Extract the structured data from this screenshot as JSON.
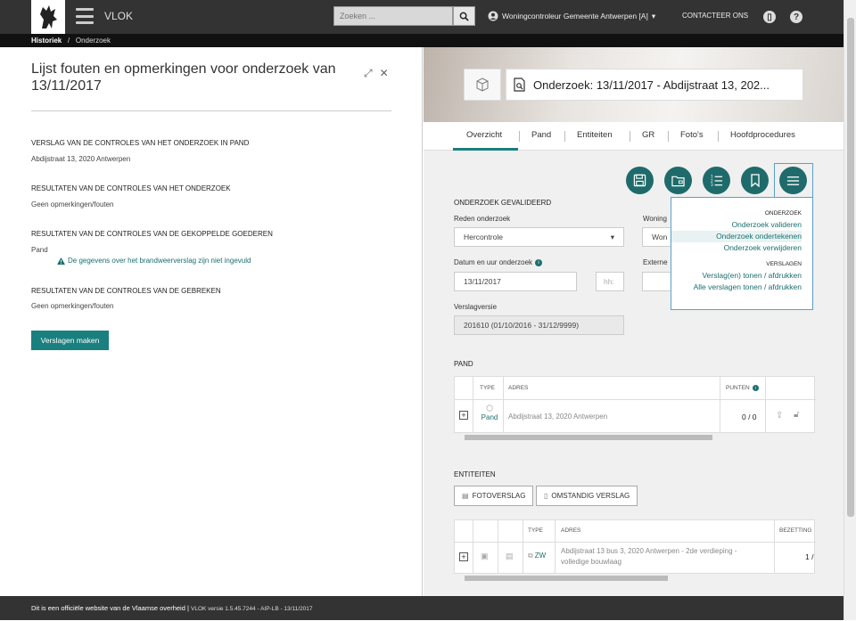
{
  "app": {
    "name": "VLOK"
  },
  "search": {
    "placeholder": "Zoeken ..."
  },
  "user": {
    "label": "Woningcontroleur Gemeente Antwerpen [A]"
  },
  "header": {
    "contact": "CONTACTEER ONS"
  },
  "breadcrumb": {
    "home": "Historiek",
    "sep": "/",
    "current": "Onderzoek"
  },
  "left": {
    "title": "Lijst fouten en opmerkingen voor onderzoek van 13/11/2017",
    "sections": [
      {
        "heading": "VERSLAG VAN DE CONTROLES VAN HET ONDERZOEK IN PAND",
        "text": "Abdijstraat 13, 2020 Antwerpen"
      },
      {
        "heading": "RESULTATEN VAN DE CONTROLES VAN HET ONDERZOEK",
        "text": "Geen opmerkingen/fouten"
      },
      {
        "heading": "RESULTATEN VAN DE CONTROLES VAN DE GEKOPPELDE GOEDEREN",
        "text": "Pand"
      },
      {
        "heading": "RESULTATEN VAN DE CONTROLES VAN DE GEBREKEN",
        "text": "Geen opmerkingen/fouten"
      }
    ],
    "warning": "De gegevens over het brandweerverslag zijn niet ingevuld",
    "button": "Verslagen maken"
  },
  "right": {
    "title": "Onderzoek: 13/11/2017 - Abdijstraat 13, 202...",
    "tabs": [
      "Overzicht",
      "Pand",
      "Entiteiten",
      "GR",
      "Foto's",
      "Hoofdprocedures"
    ],
    "dropdown": {
      "h1": "ONDERZOEK",
      "i1": "Onderzoek valideren",
      "i2": "Onderzoek ondertekenen",
      "i3": "Onderzoek verwijderen",
      "h2": "VERSLAGEN",
      "i4": "Verslag(en) tonen / afdrukken",
      "i5": "Alle verslagen tonen / afdrukken"
    },
    "form": {
      "heading": "ONDERZOEK GEVALIDEERD",
      "reden_label": "Reden onderzoek",
      "reden_value": "Hercontrole",
      "woning_label": "Woning",
      "woning_value": "Won",
      "datum_label": "Datum en uur onderzoek",
      "datum_value": "13/11/2017",
      "uur_placeholder": "hh:",
      "externe_label": "Externe",
      "versie_label": "Verslagversie",
      "versie_value": "201610 (01/10/2016 - 31/12/9999)"
    },
    "pand": {
      "heading": "PAND",
      "headers": {
        "type": "TYPE",
        "adres": "ADRES",
        "punten": "PUNTEN"
      },
      "row": {
        "type": "Pand",
        "adres": "Abdijstraat 13, 2020 Antwerpen",
        "punten": "0 / 0"
      }
    },
    "entiteiten": {
      "heading": "ENTITEITEN",
      "btn1": "FOTOVERSLAG",
      "btn2": "OMSTANDIG VERSLAG",
      "headers": {
        "type": "TYPE",
        "adres": "ADRES",
        "bezetting": "BEZETTING"
      },
      "row": {
        "type": "ZW",
        "adres": "Abdijstraat 13 bus 3, 2020 Antwerpen - 2de verdieping - volledige bouwlaag",
        "bezetting": "1 /"
      }
    }
  },
  "footer": {
    "text": "Dit is een officiële website van de Vlaamse overheid",
    "version": "VLOK versie 1.5.45.7244 - AIP-LB - 13/11/2017"
  },
  "colors": {
    "accent": "#1a7f7f",
    "topbar": "#333333",
    "link": "#1a6f6f"
  }
}
